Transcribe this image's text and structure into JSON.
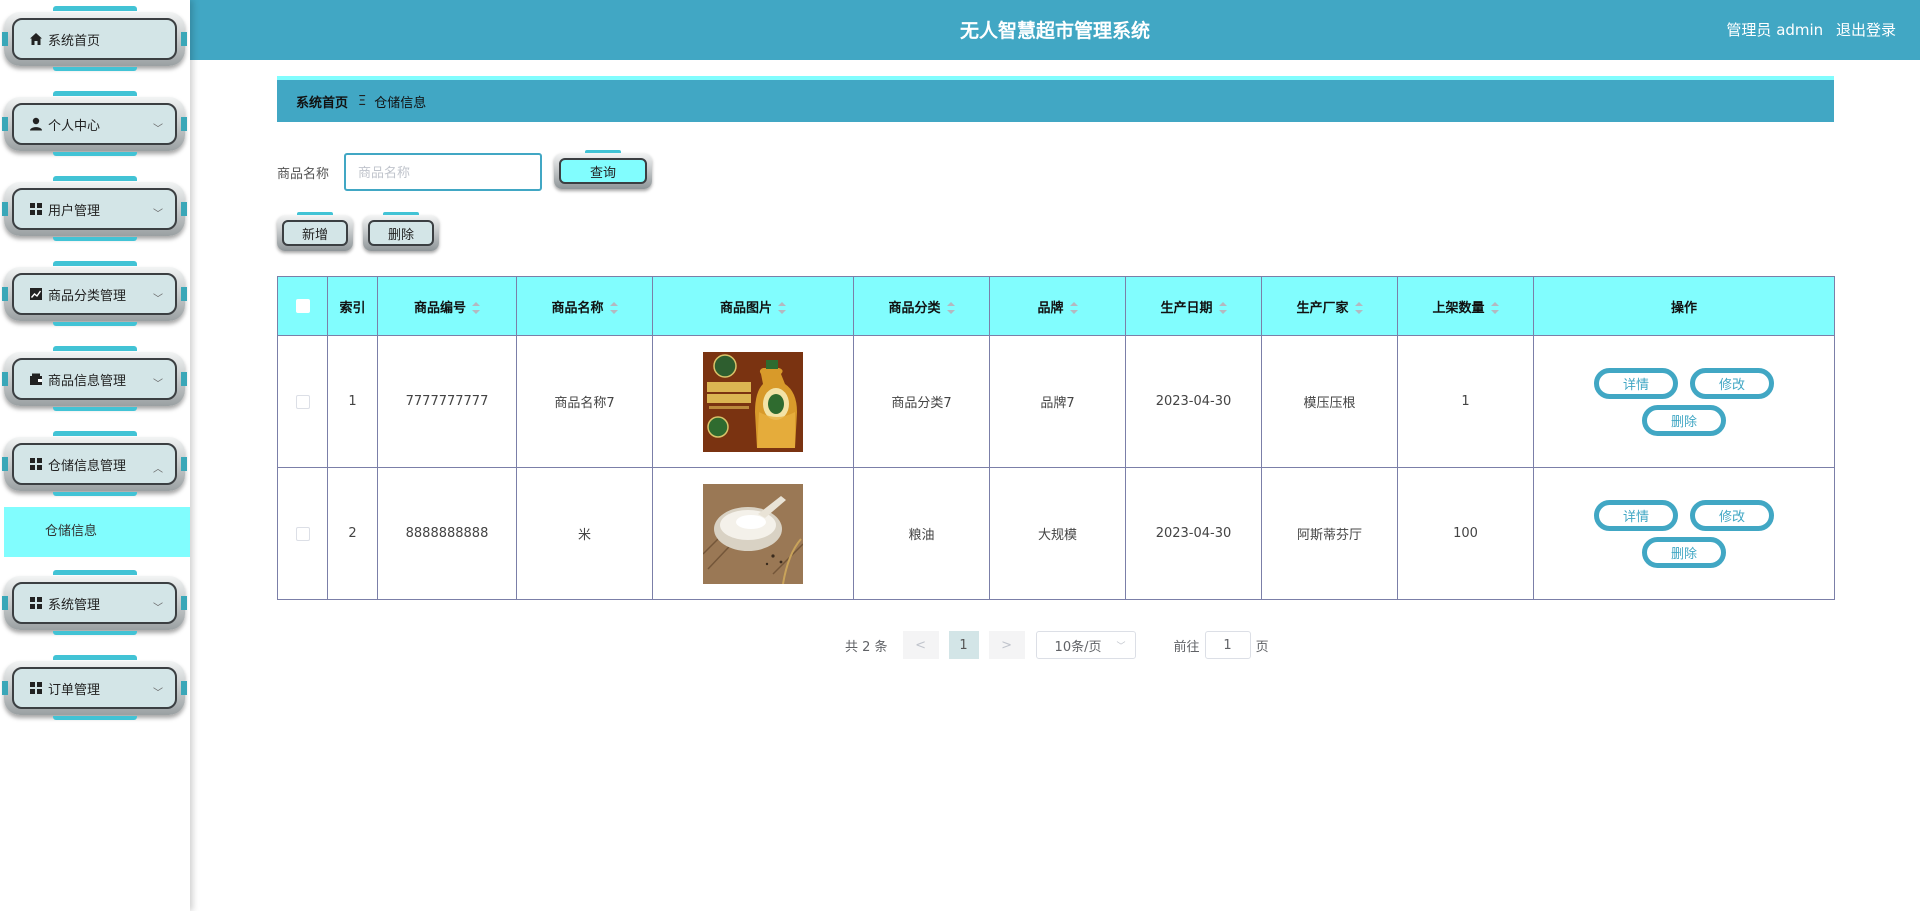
{
  "header": {
    "title": "无人智慧超市管理系统",
    "user_label": "管理员 admin",
    "logout": "退出登录"
  },
  "sidebar": {
    "items": [
      {
        "label": "系统首页",
        "icon": "home-icon",
        "has_arrow": false
      },
      {
        "label": "个人中心",
        "icon": "user-icon",
        "has_arrow": true
      },
      {
        "label": "用户管理",
        "icon": "grid-icon",
        "has_arrow": true
      },
      {
        "label": "商品分类管理",
        "icon": "chart-icon",
        "has_arrow": true
      },
      {
        "label": "商品信息管理",
        "icon": "wallet-icon",
        "has_arrow": true
      },
      {
        "label": "仓储信息管理",
        "icon": "grid-icon",
        "has_arrow": true,
        "expanded": true
      },
      {
        "label": "系统管理",
        "icon": "grid-icon",
        "has_arrow": true
      },
      {
        "label": "订单管理",
        "icon": "grid-icon",
        "has_arrow": true
      }
    ],
    "submenu": {
      "label": "仓储信息"
    }
  },
  "breadcrumb": {
    "home": "系统首页",
    "separator": "Ξ",
    "current": "仓储信息"
  },
  "search": {
    "label": "商品名称",
    "placeholder": "商品名称",
    "value": "",
    "query_button": "查询"
  },
  "actions": {
    "add": "新增",
    "delete": "删除"
  },
  "table": {
    "headers": [
      "索引",
      "商品编号",
      "商品名称",
      "商品图片",
      "商品分类",
      "品牌",
      "生产日期",
      "生产厂家",
      "上架数量",
      "操作"
    ],
    "rows": [
      {
        "index": "1",
        "code": "7777777777",
        "name": "商品名称7",
        "image": "oil-bottle-image",
        "category": "商品分类7",
        "brand": "品牌7",
        "date": "2023-04-30",
        "maker": "模压压根",
        "qty": "1"
      },
      {
        "index": "2",
        "code": "8888888888",
        "name": "米",
        "image": "rice-bowl-image",
        "category": "粮油",
        "brand": "大规模",
        "date": "2023-04-30",
        "maker": "阿斯蒂芬厅",
        "qty": "100"
      }
    ],
    "row_actions": {
      "detail": "详情",
      "edit": "修改",
      "delete": "删除"
    }
  },
  "pagination": {
    "total": "共 2 条",
    "prev": "<",
    "current_page": "1",
    "next": ">",
    "page_size": "10条/页",
    "goto_label": "前往",
    "goto_value": "1",
    "page_unit": "页"
  },
  "colors": {
    "primary": "#41a7c4",
    "cyan": "#81fdfe",
    "menu_bg": "#d3e5e7"
  }
}
